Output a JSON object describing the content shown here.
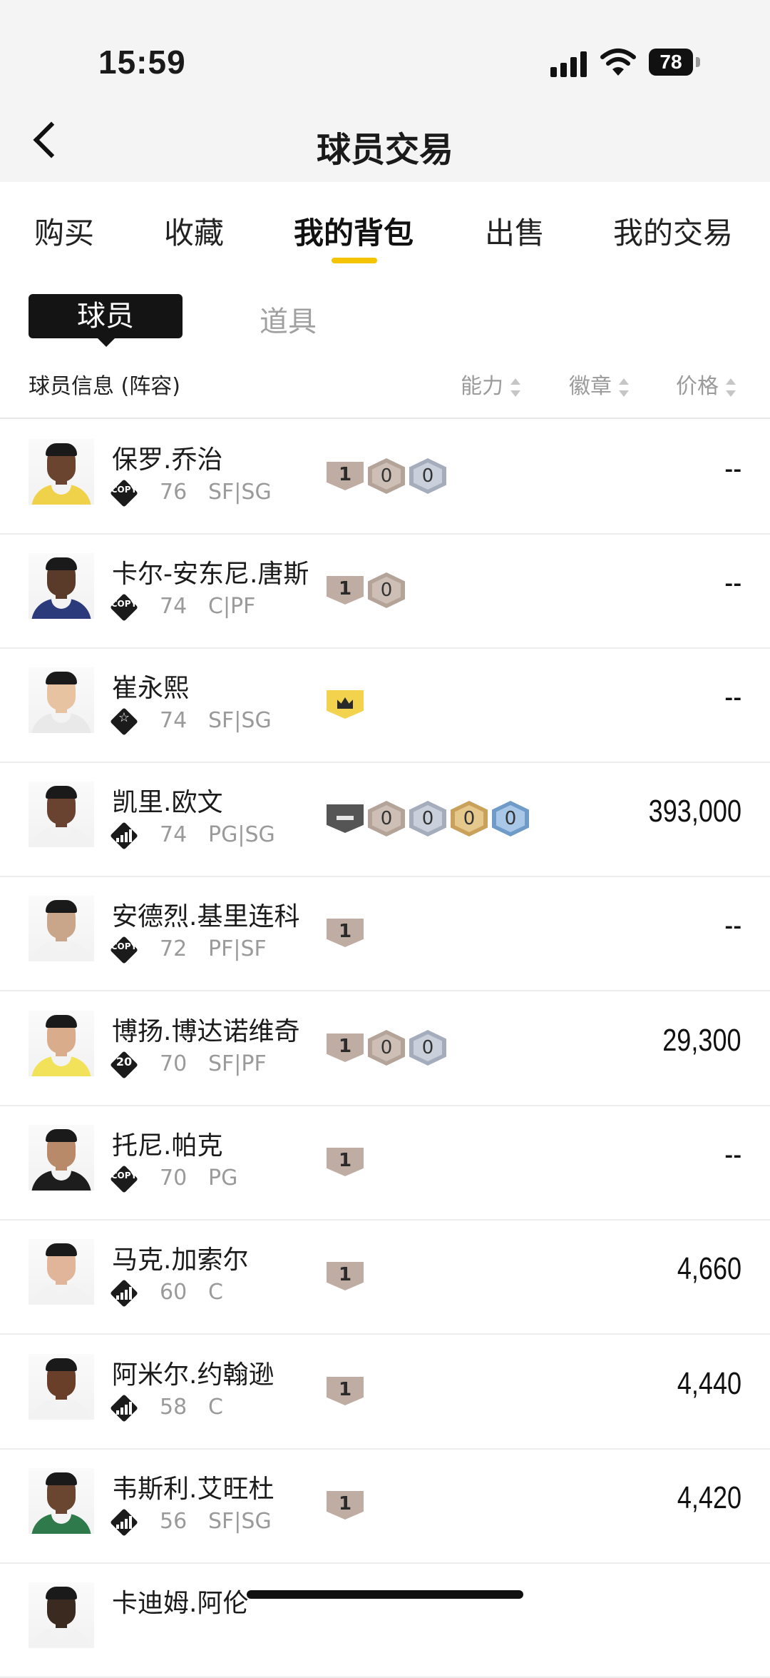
{
  "status": {
    "time": "15:59",
    "battery": "78"
  },
  "nav": {
    "title": "球员交易"
  },
  "tabs": [
    {
      "label": "购买",
      "active": false
    },
    {
      "label": "收藏",
      "active": false
    },
    {
      "label": "我的背包",
      "active": true
    },
    {
      "label": "出售",
      "active": false
    },
    {
      "label": "我的交易",
      "active": false
    }
  ],
  "segments": {
    "player": "球员",
    "items": "道具",
    "selected": "球员"
  },
  "columns": {
    "info": "球员信息 (阵容)",
    "ability": "能力",
    "badge": "徽章",
    "price": "价格"
  },
  "rows": [
    {
      "name": "保罗.乔治",
      "card": "COPY",
      "rating": "76",
      "pos": "SF|SG",
      "price": "--",
      "badges": [
        "shield-1",
        "hex-bronze-0",
        "hex-silver-0"
      ],
      "skin": "#6b4430",
      "jersey": "#f0d24a"
    },
    {
      "name": "卡尔-安东尼.唐斯",
      "card": "COPY",
      "rating": "74",
      "pos": "C|PF",
      "price": "--",
      "badges": [
        "shield-1",
        "hex-bronze-0"
      ],
      "skin": "#5a3a28",
      "jersey": "#2a3a7a"
    },
    {
      "name": "崔永熙",
      "card": "STAR",
      "rating": "74",
      "pos": "SF|SG",
      "price": "--",
      "badges": [
        "crown"
      ],
      "skin": "#e8c3a1",
      "jersey": "#e9e9e9"
    },
    {
      "name": "凯里.欧文",
      "card": "BARS",
      "rating": "74",
      "pos": "PG|SG",
      "price": "393,000",
      "badges": [
        "shield-dark",
        "hex-bronze-0",
        "hex-silver-0",
        "hex-gold-0",
        "hex-blue-0"
      ],
      "skin": "#6a4330",
      "jersey": "#f2f2f2"
    },
    {
      "name": "安德烈.基里连科",
      "card": "COPY",
      "rating": "72",
      "pos": "PF|SF",
      "price": "--",
      "badges": [
        "shield-1"
      ],
      "skin": "#c9a58a",
      "jersey": "#f2f2f2"
    },
    {
      "name": "博扬.博达诺维奇",
      "card": "20",
      "rating": "70",
      "pos": "SF|PF",
      "price": "29,300",
      "badges": [
        "shield-1",
        "hex-bronze-0",
        "hex-silver-0"
      ],
      "skin": "#d9ad8c",
      "jersey": "#f2e25a"
    },
    {
      "name": "托尼.帕克",
      "card": "COPY",
      "rating": "70",
      "pos": "PG",
      "price": "--",
      "badges": [
        "shield-1"
      ],
      "skin": "#b88a6a",
      "jersey": "#1d1d1d"
    },
    {
      "name": "马克.加索尔",
      "card": "BARS",
      "rating": "60",
      "pos": "C",
      "price": "4,660",
      "badges": [
        "shield-1"
      ],
      "skin": "#e0b59a",
      "jersey": "#f2f2f2"
    },
    {
      "name": "阿米尔.约翰逊",
      "card": "BARS",
      "rating": "58",
      "pos": "C",
      "price": "4,440",
      "badges": [
        "shield-1"
      ],
      "skin": "#6a3f2a",
      "jersey": "#f2f2f2"
    },
    {
      "name": "韦斯利.艾旺杜",
      "card": "BARS",
      "rating": "56",
      "pos": "SF|SG",
      "price": "4,420",
      "badges": [
        "shield-1"
      ],
      "skin": "#6a4530",
      "jersey": "#2e7a4a"
    },
    {
      "name": "卡迪姆.阿伦",
      "card": "BARS",
      "rating": "",
      "pos": "",
      "price": "",
      "badges": [],
      "skin": "#3a2a20",
      "jersey": "#f2f2f2"
    }
  ]
}
